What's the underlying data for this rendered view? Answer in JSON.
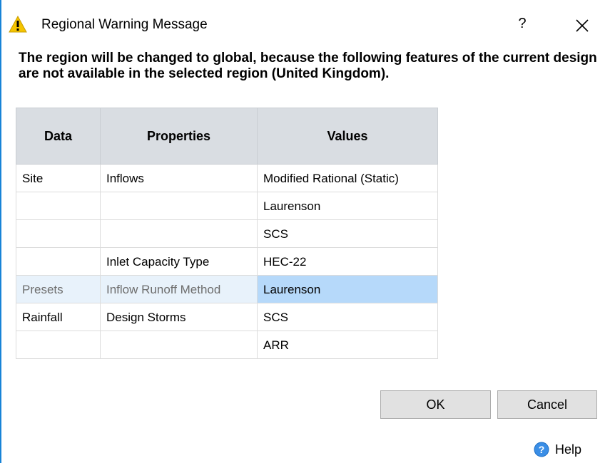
{
  "window": {
    "title": "Regional Warning Message",
    "help_symbol": "?",
    "close_symbol": "✕"
  },
  "message": "The region will be changed to global, because the following features of the current design are not available in the selected region (United Kingdom).",
  "table": {
    "headers": [
      "Data",
      "Properties",
      "Values"
    ],
    "rows": [
      [
        "Site",
        "Inflows",
        "Modified Rational (Static)"
      ],
      [
        "",
        "",
        "Laurenson"
      ],
      [
        "",
        "",
        "SCS"
      ],
      [
        "",
        "Inlet Capacity Type",
        "HEC-22"
      ],
      [
        "Presets",
        "Inflow Runoff Method",
        "Laurenson"
      ],
      [
        "Rainfall",
        "Design Storms",
        "SCS"
      ],
      [
        "",
        "",
        "ARR"
      ]
    ],
    "selected_row": 4
  },
  "buttons": {
    "ok": "OK",
    "cancel": "Cancel"
  },
  "help": {
    "label": "Help",
    "icon": "question-circle-icon"
  },
  "colors": {
    "accent": "#1883d7",
    "header_bg": "#d9dde2",
    "selected_cell": "#b6d9fa",
    "selected_row": "#e8f2fb",
    "warning": "#f5c400"
  }
}
